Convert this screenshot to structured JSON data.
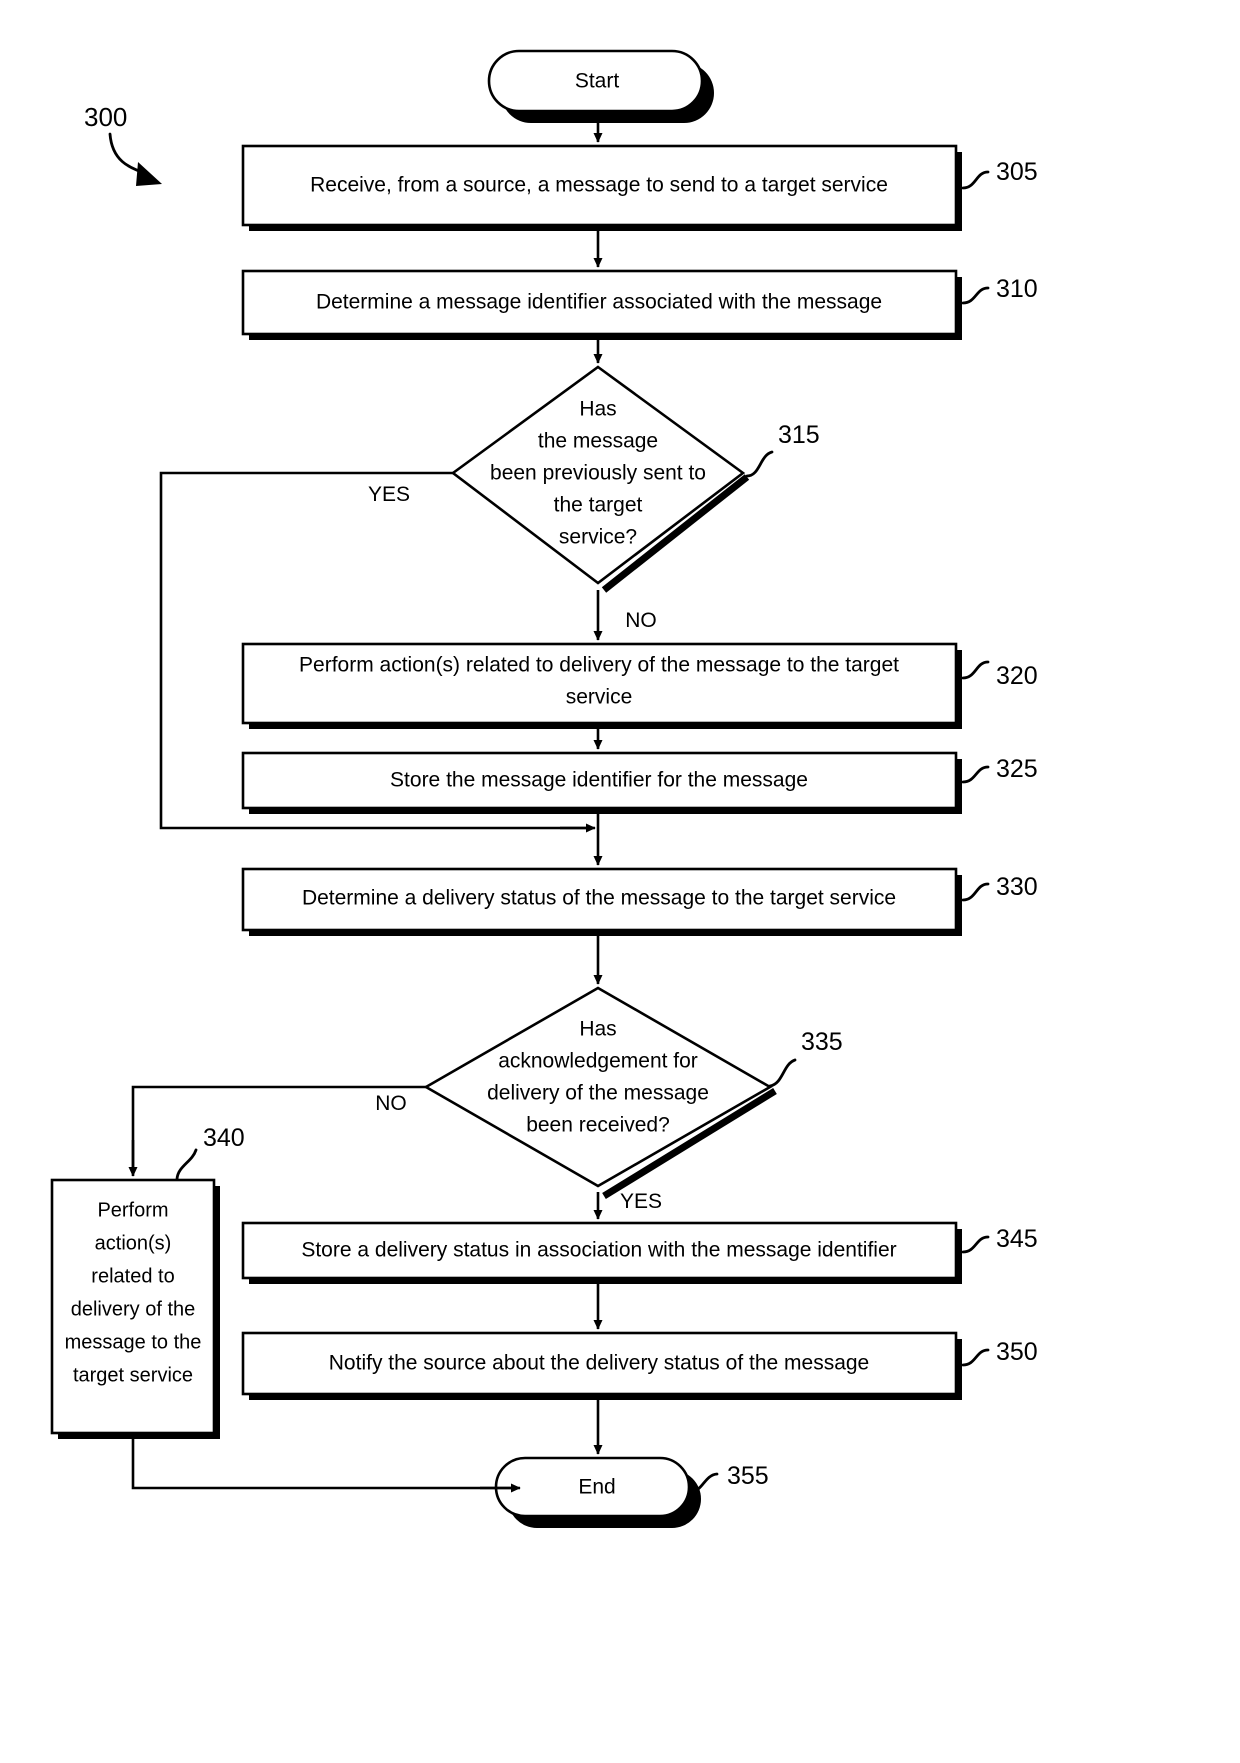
{
  "figure": {
    "number": "300",
    "type": "flowchart",
    "title": "Message delivery process flowchart"
  },
  "nodes": [
    {
      "id": "start",
      "shape": "terminator",
      "ref": "",
      "lines": [
        "Start"
      ]
    },
    {
      "id": "n305",
      "shape": "process",
      "ref": "305",
      "lines": [
        "Receive, from a source, a message to send to a target service"
      ]
    },
    {
      "id": "n310",
      "shape": "process",
      "ref": "310",
      "lines": [
        "Determine a message identifier associated with the message"
      ]
    },
    {
      "id": "n315",
      "shape": "decision",
      "ref": "315",
      "lines": [
        "Has",
        "the message",
        "been previously sent to",
        "the target",
        "service?"
      ]
    },
    {
      "id": "n320",
      "shape": "process",
      "ref": "320",
      "lines": [
        "Perform action(s) related to delivery of the message to the target",
        "service"
      ]
    },
    {
      "id": "n325",
      "shape": "process",
      "ref": "325",
      "lines": [
        "Store the message identifier for the message"
      ]
    },
    {
      "id": "n330",
      "shape": "process",
      "ref": "330",
      "lines": [
        "Determine a delivery status of the message to the target service"
      ]
    },
    {
      "id": "n335",
      "shape": "decision",
      "ref": "335",
      "lines": [
        "Has",
        "acknowledgement for",
        "delivery of the message",
        "been received?"
      ]
    },
    {
      "id": "n340",
      "shape": "process",
      "ref": "340",
      "lines": [
        "Perform",
        "action(s)",
        "related to",
        "delivery of the",
        "message to the",
        "target service"
      ]
    },
    {
      "id": "n345",
      "shape": "process",
      "ref": "345",
      "lines": [
        "Store a delivery status in association with the message identifier"
      ]
    },
    {
      "id": "n350",
      "shape": "process",
      "ref": "350",
      "lines": [
        "Notify the source about the delivery status of the message"
      ]
    },
    {
      "id": "end",
      "shape": "terminator",
      "ref": "355",
      "lines": [
        "End"
      ]
    }
  ],
  "edge_labels": {
    "yes_315": "YES",
    "no_315": "NO",
    "no_335": "NO",
    "yes_335": "YES"
  },
  "colors": {
    "stroke": "#000000",
    "fill": "#ffffff",
    "background": "#ffffff"
  }
}
